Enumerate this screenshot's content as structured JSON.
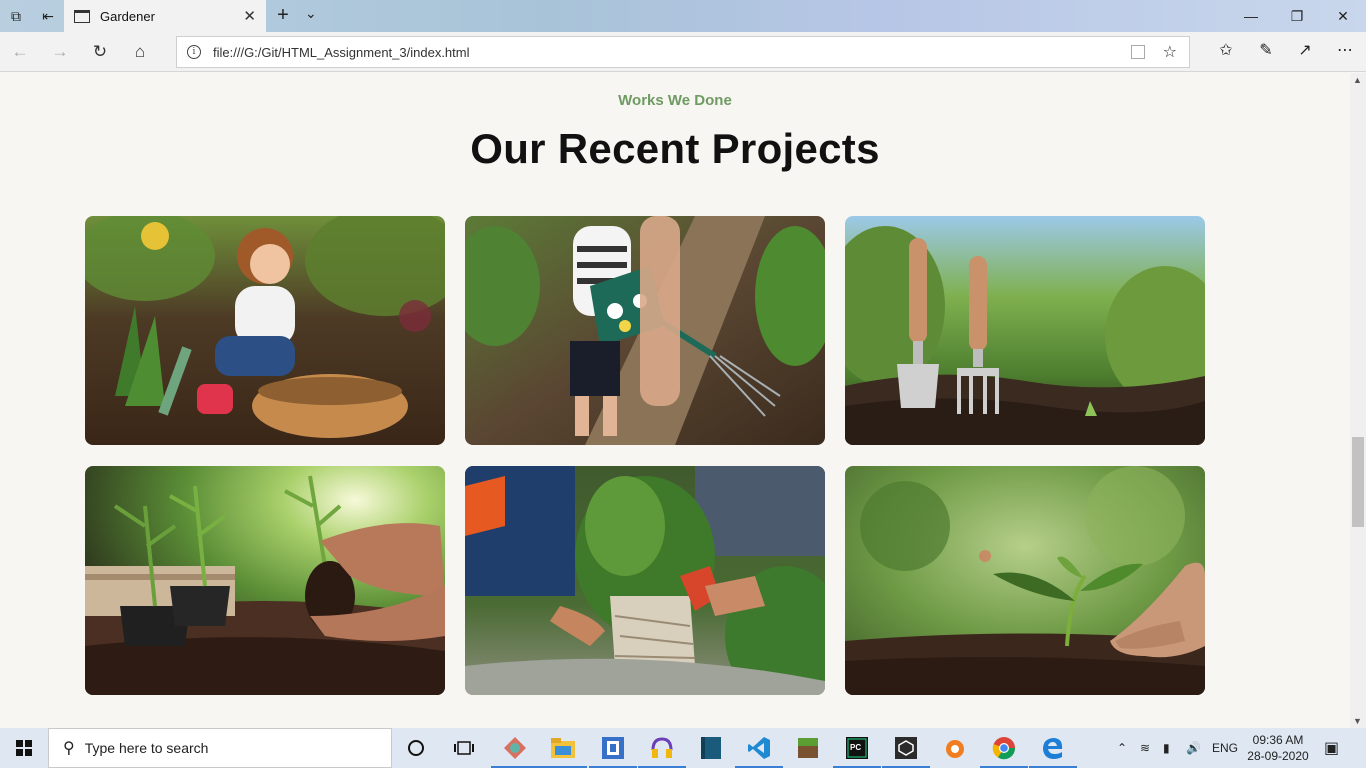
{
  "browser": {
    "tab_title": "Gardener",
    "url": "file:///G:/Git/HTML_Assignment_3/index.html"
  },
  "section": {
    "eyebrow": "Works We Done",
    "headline": "Our Recent Projects",
    "accent_color": "#6f9b62"
  },
  "projects": [
    {
      "icon": "child-picking-strawberry-photo"
    },
    {
      "icon": "child-watering-can-photo"
    },
    {
      "icon": "trowel-and-fork-photo"
    },
    {
      "icon": "hands-holding-seedling-photo"
    },
    {
      "icon": "kids-planting-shrub-photo"
    },
    {
      "icon": "hand-with-sprout-photo"
    }
  ],
  "taskbar": {
    "search_placeholder": "Type here to search",
    "language": "ENG",
    "time": "09:36 AM",
    "date": "28-09-2020"
  }
}
